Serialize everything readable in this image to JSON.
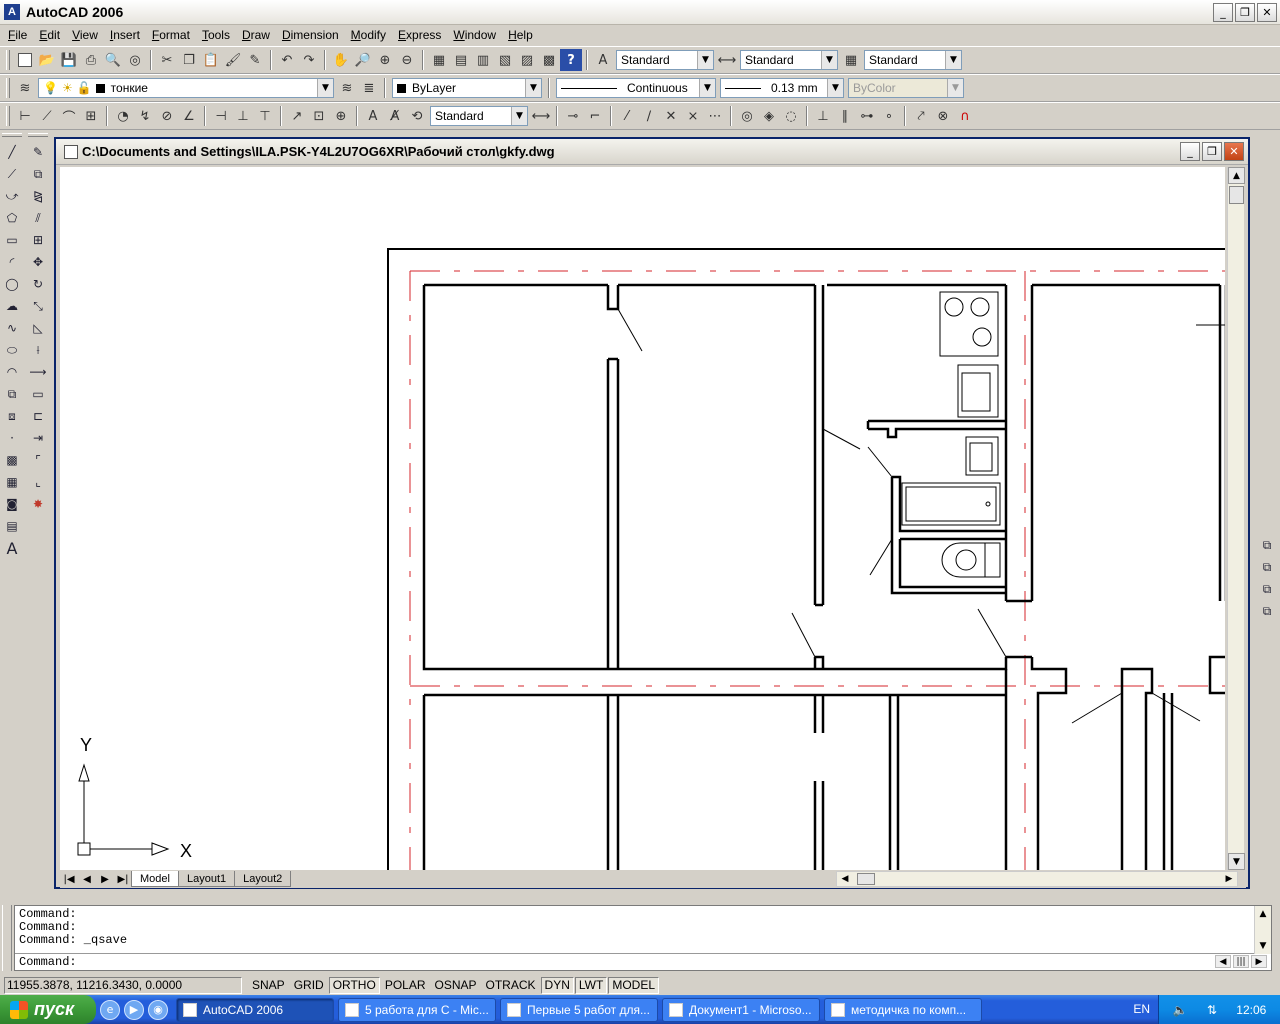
{
  "window": {
    "title": "AutoCAD 2006",
    "min": "_",
    "max": "❐",
    "close": "✕"
  },
  "menu": [
    "File",
    "Edit",
    "View",
    "Insert",
    "Format",
    "Tools",
    "Draw",
    "Dimension",
    "Modify",
    "Express",
    "Window",
    "Help"
  ],
  "toolbars": {
    "text_style": "Standard",
    "dim_style": "Standard",
    "table_style": "Standard",
    "layer": "тонкие",
    "color": "ByLayer",
    "linetype": "Continuous",
    "lineweight": "0.13 mm",
    "plotstyle": "ByColor",
    "dim_style2": "Standard"
  },
  "drawing": {
    "title": "C:\\Documents and Settings\\ILA.PSK-Y4L2U7OG6XR\\Рабочий стол\\gkfy.dwg",
    "ucs_x": "X",
    "ucs_y": "Y"
  },
  "tabs": [
    "Model",
    "Layout1",
    "Layout2"
  ],
  "command": {
    "history": [
      "Command:",
      "Command:",
      "Command:  _qsave"
    ],
    "prompt": "Command:"
  },
  "status": {
    "coords": "11955.3878, 11216.3430, 0.0000",
    "buttons": [
      {
        "label": "SNAP",
        "on": false
      },
      {
        "label": "GRID",
        "on": false
      },
      {
        "label": "ORTHO",
        "on": true
      },
      {
        "label": "POLAR",
        "on": false
      },
      {
        "label": "OSNAP",
        "on": false
      },
      {
        "label": "OTRACK",
        "on": false
      },
      {
        "label": "DYN",
        "on": true
      },
      {
        "label": "LWT",
        "on": true
      },
      {
        "label": "MODEL",
        "on": true
      }
    ]
  },
  "taskbar": {
    "start": "пуск",
    "tasks": [
      {
        "label": "AutoCAD 2006",
        "active": true
      },
      {
        "label": "5 работа для C - Mic...",
        "active": false
      },
      {
        "label": "Первые 5 работ для...",
        "active": false
      },
      {
        "label": "Документ1 - Microso...",
        "active": false
      },
      {
        "label": "методичка по комп...",
        "active": false
      }
    ],
    "lang": "EN",
    "clock": "12:06"
  },
  "colors": {
    "axis_red": "#d6262b",
    "wall": "#000000",
    "taskbar_blue": "#245edb"
  }
}
